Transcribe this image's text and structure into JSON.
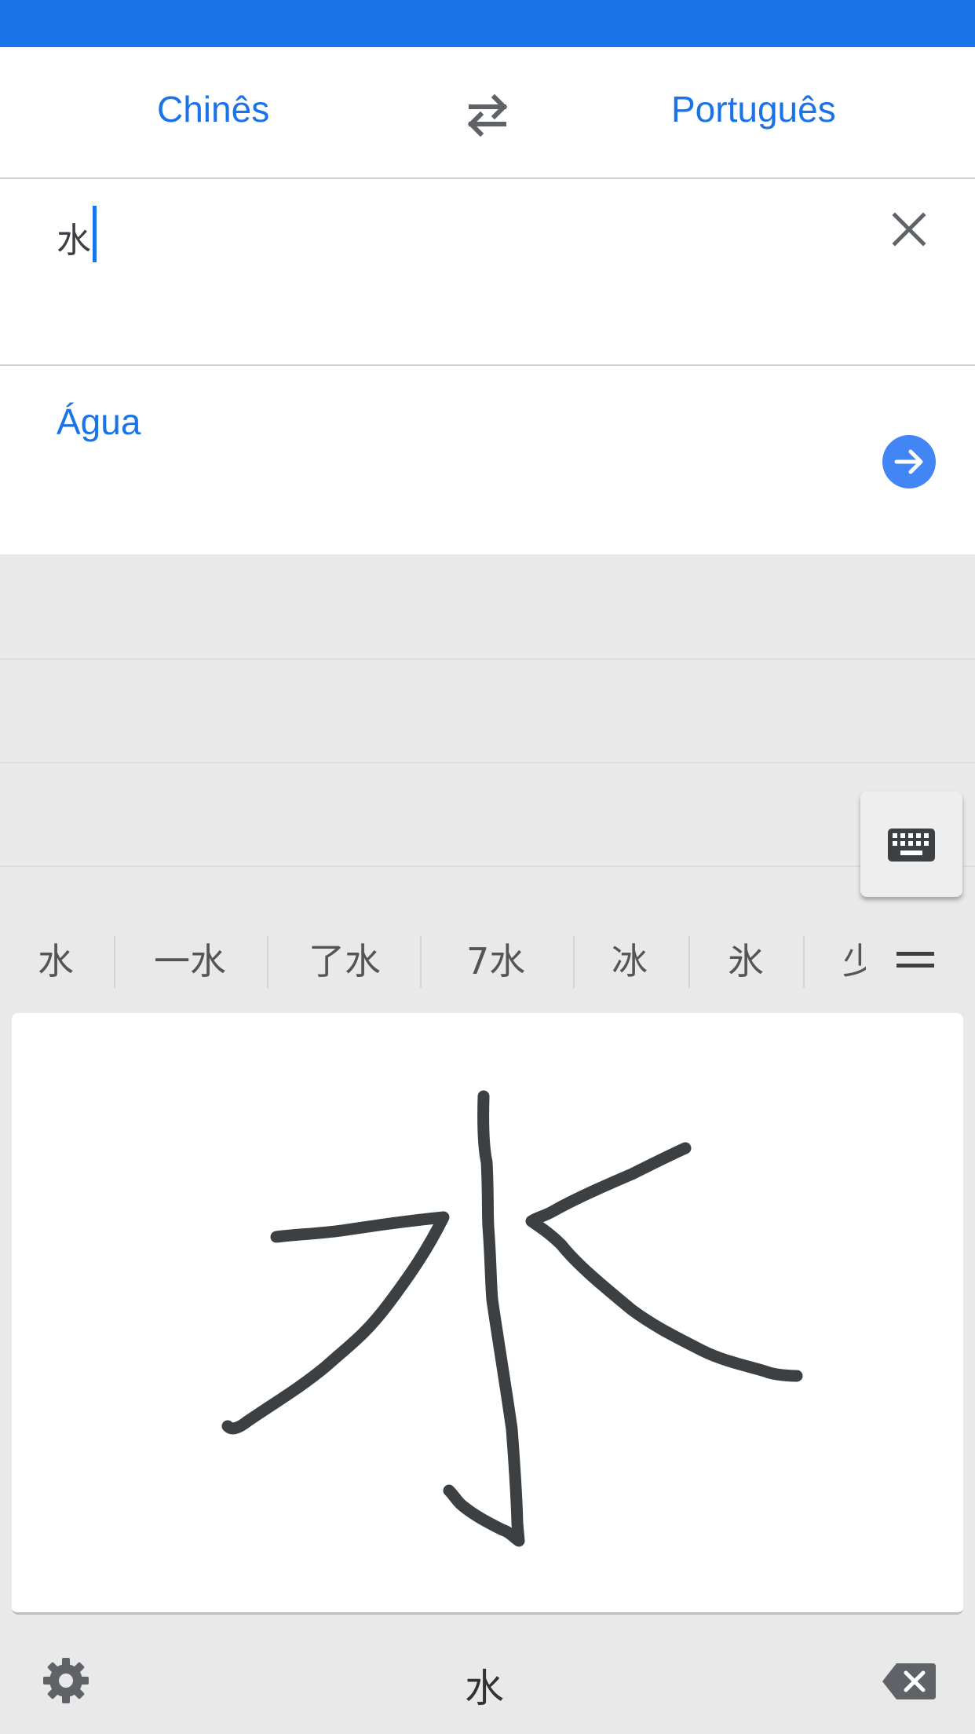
{
  "colors": {
    "accent": "#1a73e8",
    "go_button": "#4285f4",
    "ink": "#3c4043"
  },
  "language_bar": {
    "source_label": "Chinês",
    "target_label": "Português",
    "swap_icon": "swap-arrows-icon"
  },
  "input": {
    "value": "水",
    "clear_icon": "close-icon"
  },
  "result": {
    "text": "Água",
    "open_icon": "arrow-right-circle-icon"
  },
  "keyboard_toggle_icon": "keyboard-icon",
  "suggestions": [
    "水",
    "一水",
    "了水",
    "7水",
    "冰",
    "氷",
    "少"
  ],
  "more_suggestions_icon": "menu-lines-icon",
  "handwriting_canvas": {
    "icon": "handwriting-strokes"
  },
  "bottom_bar": {
    "settings_icon": "gear-icon",
    "space_label": "水",
    "backspace_icon": "backspace-icon"
  }
}
